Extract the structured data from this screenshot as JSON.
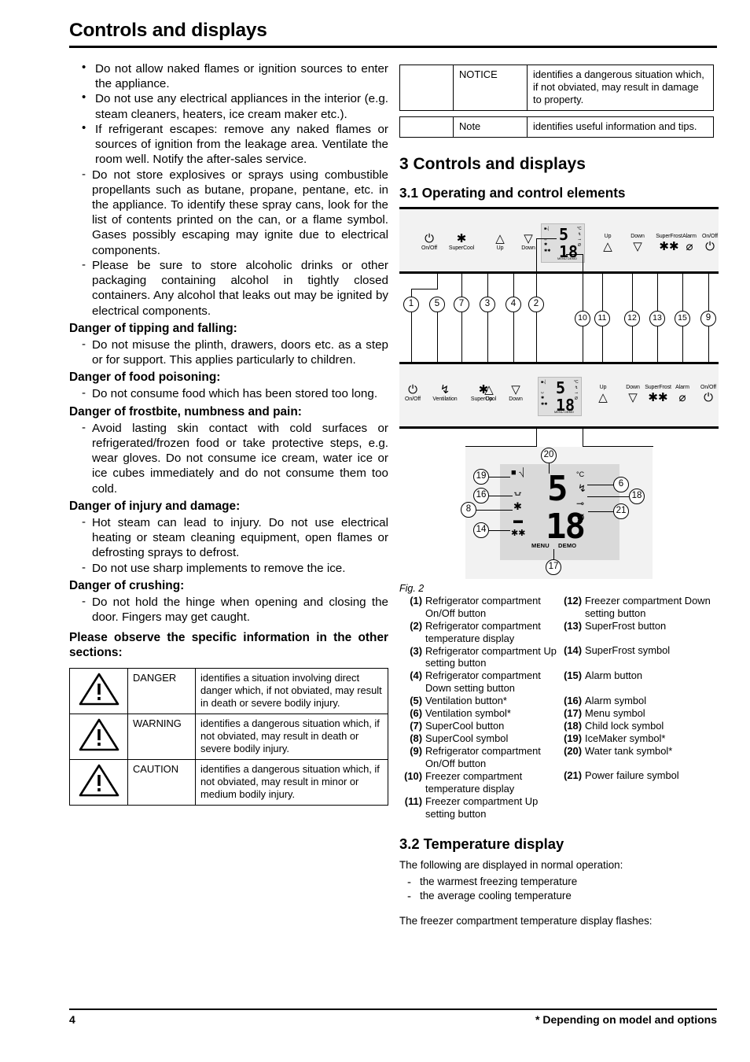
{
  "header": {
    "title": "Controls and displays"
  },
  "left": {
    "lead_bullets": [
      "Do not allow naked flames or ignition sources to enter the appliance.",
      "Do not use any electrical appliances in the interior (e.g. steam cleaners, heaters, ice cream maker etc.).",
      "If refrigerant escapes: remove any naked flames or sources of ignition from the leakage area. Ventilate the room well. Notify the after-sales service."
    ],
    "lead_dashes": [
      "Do not store explosives or sprays using combustible propellants such as butane, propane, pentane, etc. in the appliance. To identify these spray cans, look for the list of contents printed on the can, or a flame symbol. Gases possibly escaping may ignite due to electrical components.",
      "Please be sure to store alcoholic drinks or other packaging containing alcohol in tightly closed containers. Any alcohol that leaks out may be ignited by electrical components."
    ],
    "sections": [
      {
        "heading": "Danger of tipping and falling:",
        "items": [
          "Do not misuse the plinth, drawers, doors etc. as a step or for support. This applies particularly to children."
        ]
      },
      {
        "heading": "Danger of food poisoning:",
        "items": [
          "Do not consume food which has been stored too long."
        ]
      },
      {
        "heading": "Danger of frostbite, numbness and pain:",
        "items": [
          "Avoid lasting skin contact with cold surfaces or refrigerated/frozen food or take protective steps, e.g. wear gloves. Do not consume ice cream, water ice or ice cubes immediately and do not consume them too cold."
        ]
      },
      {
        "heading": "Danger of injury and damage:",
        "items": [
          "Hot steam can lead to injury. Do not use electrical heating or steam cleaning equipment, open flames or defrosting sprays to defrost.",
          "Do not use sharp implements to remove the ice."
        ]
      },
      {
        "heading": "Danger of crushing:",
        "items": [
          "Do not hold the hinge when opening and closing the door. Fingers may get caught."
        ]
      }
    ],
    "observe_heading": "Please observe the specific information in the other sections:",
    "warning_table": [
      {
        "icon": "warning-triangle-icon",
        "keyword": "DANGER",
        "description": "identifies a situation involving direct danger which, if not obviated, may result in death or severe bodily injury."
      },
      {
        "icon": "warning-triangle-icon",
        "keyword": "WARNING",
        "description": "identifies a dangerous situation which, if not obviated, may result in death or severe bodily injury."
      },
      {
        "icon": "warning-triangle-icon",
        "keyword": "CAUTION",
        "description": "identifies a dangerous situation which, if not obviated, may result in minor or medium bodily injury."
      }
    ]
  },
  "right": {
    "notice_table": [
      {
        "keyword": "NOTICE",
        "description": "identifies a dangerous situation which, if not obviated, may result in damage to property."
      }
    ],
    "note_table": [
      {
        "keyword": "Note",
        "description": "identifies useful information and tips."
      }
    ],
    "section3_heading": "3 Controls and displays",
    "section31_heading": "3.1 Operating and control elements",
    "fig_caption": "Fig. 2",
    "figure": {
      "panel_top_left_controls": [
        {
          "glyph": "power-icon",
          "label": "On/Off"
        },
        {
          "glyph": "supercool-icon",
          "label": "SuperCool"
        },
        {
          "glyph": "up-triangle-icon",
          "label": "Up"
        },
        {
          "glyph": "down-triangle-icon",
          "label": "Down"
        }
      ],
      "panel_top_right_controls": [
        {
          "glyph": "up-triangle-icon",
          "label": "Up"
        },
        {
          "glyph": "down-triangle-icon",
          "label": "Down"
        },
        {
          "glyph": "superfrost-icon",
          "label": "SuperFrost"
        },
        {
          "glyph": "alarm-icon",
          "label": "Alarm"
        },
        {
          "glyph": "power-icon",
          "label": "On/Off"
        }
      ],
      "panel_bottom_left_controls": [
        {
          "glyph": "power-icon",
          "label": "On/Off"
        },
        {
          "glyph": "ventilation-icon",
          "label": "Ventilation"
        },
        {
          "glyph": "supercool-icon",
          "label": "SuperCool"
        },
        {
          "glyph": "up-triangle-icon",
          "label": "Up"
        },
        {
          "glyph": "down-triangle-icon",
          "label": "Down"
        }
      ],
      "panel_bottom_right_controls": [
        {
          "glyph": "up-triangle-icon",
          "label": "Up"
        },
        {
          "glyph": "down-triangle-icon",
          "label": "Down"
        },
        {
          "glyph": "superfrost-icon",
          "label": "SuperFrost"
        },
        {
          "glyph": "alarm-icon",
          "label": "Alarm"
        },
        {
          "glyph": "power-icon",
          "label": "On/Off"
        }
      ],
      "lcd": {
        "top_digit": "5",
        "bottom_digit": "18",
        "unit": "°C",
        "menu_label": "MENU",
        "demo_label": "DEMO"
      },
      "callouts_top_row": [
        "1",
        "5",
        "7",
        "3",
        "4",
        "2"
      ],
      "callouts_top_row_right": [
        "10",
        "11",
        "12",
        "13",
        "15",
        "9"
      ],
      "callouts_lcd": [
        "20",
        "19",
        "16",
        "8",
        "14",
        "6",
        "18",
        "21",
        "17"
      ]
    },
    "legend_left": [
      {
        "num": "(1)",
        "text": "Refrigerator compartment On/Off button"
      },
      {
        "num": "(2)",
        "text": "Refrigerator compartment temperature display"
      },
      {
        "num": "(3)",
        "text": "Refrigerator compartment Up setting button"
      },
      {
        "num": "(4)",
        "text": "Refrigerator compartment Down setting button"
      },
      {
        "num": "(5)",
        "text": "Ventilation button*"
      },
      {
        "num": "(6)",
        "text": "Ventilation symbol*"
      },
      {
        "num": "(7)",
        "text": "SuperCool button"
      },
      {
        "num": "(8)",
        "text": "SuperCool symbol"
      },
      {
        "num": "(9)",
        "text": "Refrigerator compartment On/Off button"
      },
      {
        "num": "(10)",
        "text": "Freezer compartment temperature display"
      },
      {
        "num": "(11)",
        "text": "Freezer compartment Up setting button"
      }
    ],
    "legend_right": [
      {
        "num": "(12)",
        "text": "Freezer compartment Down setting button"
      },
      {
        "num": "(13)",
        "text": "SuperFrost button"
      },
      {
        "num": "(14)",
        "text": "SuperFrost symbol"
      },
      {
        "num": "(15)",
        "text": "Alarm button"
      },
      {
        "num": "(16)",
        "text": "Alarm symbol"
      },
      {
        "num": "(17)",
        "text": "Menu symbol"
      },
      {
        "num": "(18)",
        "text": "Child lock symbol"
      },
      {
        "num": "(19)",
        "text": "IceMaker symbol*"
      },
      {
        "num": "(20)",
        "text": "Water tank symbol*"
      },
      {
        "num": "(21)",
        "text": "Power failure symbol"
      }
    ],
    "section32_heading": "3.2 Temperature display",
    "s32_intro": "The following are displayed in normal operation:",
    "s32_items": [
      "the warmest freezing temperature",
      "the average cooling temperature"
    ],
    "s32_outro": "The freezer compartment temperature display flashes:"
  },
  "footer": {
    "page_number": "4",
    "note": "* Depending on model and options"
  }
}
